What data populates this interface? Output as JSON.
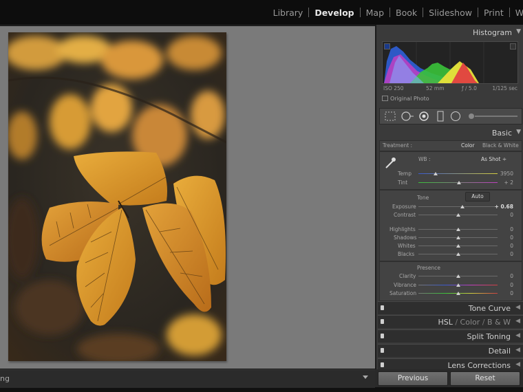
{
  "modules": {
    "library": "Library",
    "develop": "Develop",
    "map": "Map",
    "book": "Book",
    "slideshow": "Slideshow",
    "print": "Print",
    "web": "Web"
  },
  "toolbar": {
    "text": "ng"
  },
  "histogram": {
    "title": "Histogram",
    "iso": "ISO 250",
    "focal": "52 mm",
    "aperture": "ƒ / 5.0",
    "shutter": "1/125 sec",
    "original_photo": "Original Photo"
  },
  "basic": {
    "title": "Basic",
    "treatment_label": "Treatment :",
    "color": "Color",
    "bw": "Black & White",
    "wb_label": "WB :",
    "wb_value": "As Shot ÷",
    "tone_label": "Tone",
    "auto": "Auto",
    "presence_label": "Presence",
    "sliders": {
      "temp": {
        "label": "Temp",
        "value": "3950",
        "position": 0.22
      },
      "tint": {
        "label": "Tint",
        "value": "+ 2",
        "position": 0.51
      },
      "exposure": {
        "label": "Exposure",
        "value": "+ 0.68",
        "position": 0.56
      },
      "contrast": {
        "label": "Contrast",
        "value": "0",
        "position": 0.5
      },
      "highlights": {
        "label": "Highlights",
        "value": "0",
        "position": 0.5
      },
      "shadows": {
        "label": "Shadows",
        "value": "0",
        "position": 0.5
      },
      "whites": {
        "label": "Whites",
        "value": "0",
        "position": 0.5
      },
      "blacks": {
        "label": "Blacks",
        "value": "0",
        "position": 0.5
      },
      "clarity": {
        "label": "Clarity",
        "value": "0",
        "position": 0.5
      },
      "vibrance": {
        "label": "Vibrance",
        "value": "0",
        "position": 0.5
      },
      "saturation": {
        "label": "Saturation",
        "value": "0",
        "position": 0.5
      }
    }
  },
  "collapsed_panels": {
    "tone_curve": "Tone Curve",
    "hsl": "HSL",
    "hsl_sep1": "/",
    "color": "Color",
    "hsl_sep2": "/",
    "bw": "B & W",
    "split_toning": "Split Toning",
    "detail": "Detail",
    "lens_corrections": "Lens Corrections"
  },
  "buttons": {
    "previous": "Previous",
    "reset": "Reset"
  },
  "icons": {
    "panel_expanded": "triangle-down-icon",
    "panel_collapsed": "triangle-left-icon",
    "eyedropper": "eyedropper-icon",
    "grid": "crop-overlay-icon",
    "spot": "spot-removal-icon",
    "redeye": "red-eye-icon",
    "gradient": "graduated-filter-icon",
    "radial": "radial-filter-icon",
    "brush": "adjustment-brush-icon"
  },
  "colors": {
    "panel_bg": "#3a3a3a",
    "canvas_bg": "#7a7a7a",
    "active_module": "#e6e6e6"
  }
}
